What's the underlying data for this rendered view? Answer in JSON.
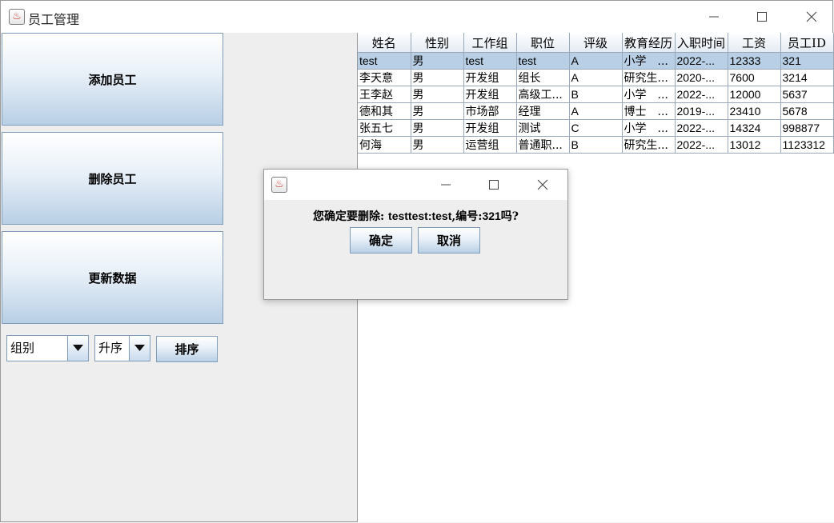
{
  "window": {
    "title": "员工管理"
  },
  "sidebar": {
    "add_label": "添加员工",
    "delete_label": "删除员工",
    "refresh_label": "更新数据",
    "group_select": "组别",
    "order_select": "升序",
    "sort_label": "排序"
  },
  "table": {
    "columns": [
      "姓名",
      "性别",
      "工作组",
      "职位",
      "评级",
      "教育经历",
      "入职时间",
      "工资",
      "员工ID"
    ],
    "rows": [
      [
        "test",
        "男",
        "test",
        "test",
        "A",
        "小学　...",
        "2022-...",
        "12333",
        "321"
      ],
      [
        "李天意",
        "男",
        "开发组",
        "组长",
        "A",
        "研究生...",
        "2020-...",
        "7600",
        "3214"
      ],
      [
        "王李赵",
        "男",
        "开发组",
        "高级工...",
        "B",
        "小学　...",
        "2022-...",
        "12000",
        "5637"
      ],
      [
        "德和其",
        "男",
        "市场部",
        "经理",
        "A",
        "博士　...",
        "2019-...",
        "23410",
        "5678"
      ],
      [
        "张五七",
        "男",
        "开发组",
        "测试",
        "C",
        "小学　...",
        "2022-...",
        "14324",
        "998877"
      ],
      [
        "何海",
        "男",
        "运营组",
        "普通职...",
        "B",
        "研究生...",
        "2022-...",
        "13012",
        "1123312"
      ]
    ],
    "selected_row": 0
  },
  "dialog": {
    "title": "",
    "message_prefix": "您确定要删除: ",
    "message_name": "testtest:test",
    "message_mid": ",编号:",
    "message_id": "321",
    "message_suffix": "吗?",
    "ok_label": "确定",
    "cancel_label": "取消"
  },
  "colors": {
    "selection": "#b8cfe5",
    "button_gradient_bottom": "#b8cfe5",
    "border": "#7f9db9"
  },
  "icons": [
    "java-app-icon",
    "minimize-icon",
    "maximize-icon",
    "close-icon",
    "dropdown-arrow-icon"
  ]
}
